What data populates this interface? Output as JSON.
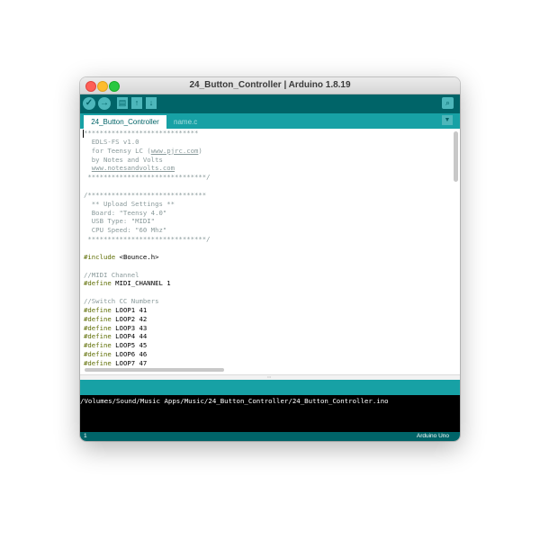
{
  "window": {
    "title": "24_Button_Controller | Arduino 1.8.19"
  },
  "toolbar": {
    "verify_icon": "check-icon",
    "upload_icon": "arrow-right-icon",
    "new_icon": "new-file-icon",
    "open_icon": "open-arrow-up-icon",
    "save_icon": "save-arrow-down-icon",
    "serial_icon": "magnifier-icon",
    "accent": "#006468",
    "button_color": "#4db7bb"
  },
  "tabs": [
    {
      "label": "24_Button_Controller",
      "active": true
    },
    {
      "label": "name.c",
      "active": false
    }
  ],
  "editor": {
    "lines": [
      {
        "text": "*****************************",
        "kind": "cmt"
      },
      {
        "text": "  EDLS-FS v1.0",
        "kind": "cmt"
      },
      {
        "text": "  for Teensy LC (",
        "kind": "cmt",
        "link": "www.pjrc.com",
        "after": ")"
      },
      {
        "text": "  by Notes and Volts",
        "kind": "cmt"
      },
      {
        "text": "  ",
        "kind": "cmt",
        "link": "www.notesandvolts.com",
        "after": ""
      },
      {
        "text": " ******************************/",
        "kind": "cmt"
      },
      {
        "text": "",
        "kind": "blank"
      },
      {
        "text": "/******************************",
        "kind": "cmt"
      },
      {
        "text": "  ** Upload Settings **",
        "kind": "cmt"
      },
      {
        "text": "  Board: \"Teensy 4.0\"",
        "kind": "cmt"
      },
      {
        "text": "  USB Type: \"MIDI\"",
        "kind": "cmt"
      },
      {
        "text": "  CPU Speed: \"60 Mhz\"",
        "kind": "cmt"
      },
      {
        "text": " ******************************/",
        "kind": "cmt"
      },
      {
        "text": "",
        "kind": "blank"
      },
      {
        "directive": "#include",
        "text": " <Bounce.h>",
        "kind": "dir"
      },
      {
        "text": "",
        "kind": "blank"
      },
      {
        "text": "//MIDI Channel",
        "kind": "cmt"
      },
      {
        "directive": "#define",
        "text": " MIDI_CHANNEL 1",
        "kind": "dir"
      },
      {
        "text": "",
        "kind": "blank"
      },
      {
        "text": "//Switch CC Numbers",
        "kind": "cmt"
      },
      {
        "directive": "#define",
        "text": " LOOP1 41",
        "kind": "dir"
      },
      {
        "directive": "#define",
        "text": " LOOP2 42",
        "kind": "dir"
      },
      {
        "directive": "#define",
        "text": " LOOP3 43",
        "kind": "dir"
      },
      {
        "directive": "#define",
        "text": " LOOP4 44",
        "kind": "dir"
      },
      {
        "directive": "#define",
        "text": " LOOP5 45",
        "kind": "dir"
      },
      {
        "directive": "#define",
        "text": " LOOP6 46",
        "kind": "dir"
      },
      {
        "directive": "#define",
        "text": " LOOP7 47",
        "kind": "dir"
      }
    ]
  },
  "console": {
    "text": "/Volumes/Sound/Music Apps/Music/24_Button_Controller/24_Button_Controller.ino"
  },
  "footer": {
    "line_number": "1",
    "board": "Arduino Uno"
  }
}
